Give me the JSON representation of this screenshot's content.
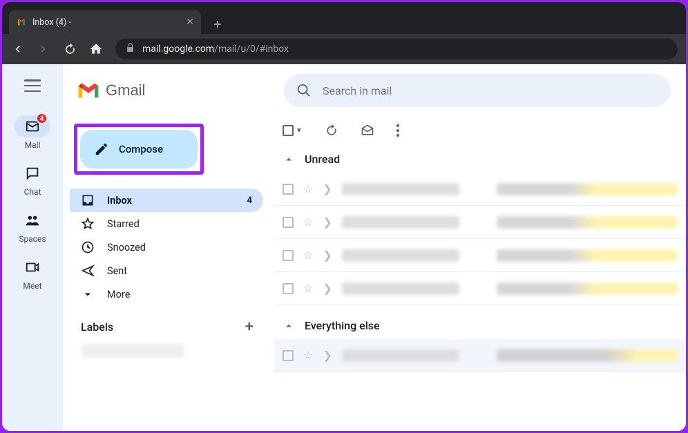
{
  "browser": {
    "tab_title": "Inbox (4) -",
    "url_host": "mail.google.com",
    "url_path": "/mail/u/0/#inbox"
  },
  "rail": {
    "items": [
      {
        "label": "Mail",
        "icon": "mail-icon",
        "badge": "4"
      },
      {
        "label": "Chat",
        "icon": "chat-icon"
      },
      {
        "label": "Spaces",
        "icon": "spaces-icon"
      },
      {
        "label": "Meet",
        "icon": "meet-icon"
      }
    ]
  },
  "header": {
    "product": "Gmail",
    "search_placeholder": "Search in mail"
  },
  "sidebar": {
    "compose_label": "Compose",
    "items": [
      {
        "label": "Inbox",
        "count": "4"
      },
      {
        "label": "Starred"
      },
      {
        "label": "Snoozed"
      },
      {
        "label": "Sent"
      },
      {
        "label": "More"
      }
    ],
    "labels_heading": "Labels"
  },
  "list": {
    "section_unread": "Unread",
    "section_else": "Everything else",
    "unread_count": 4,
    "else_count": 1
  }
}
